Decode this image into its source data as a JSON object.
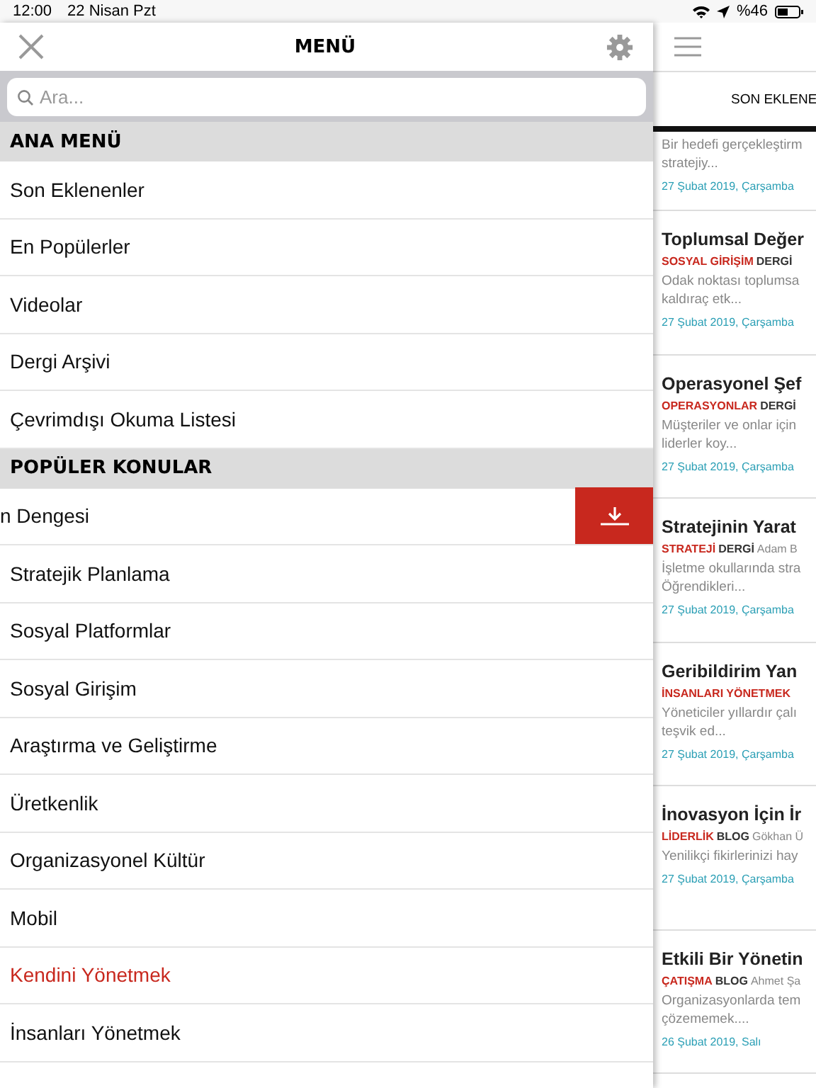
{
  "status_bar": {
    "time": "12:00",
    "date": "22 Nisan Pzt",
    "battery": "%46"
  },
  "menu": {
    "title": "MENÜ",
    "search": {
      "placeholder": "Ara..."
    },
    "sections": [
      {
        "title": "ANA MENÜ",
        "items": [
          {
            "label": "Son Eklenenler",
            "selected": false,
            "swiped": false
          },
          {
            "label": "En Popülerler",
            "selected": false,
            "swiped": false
          },
          {
            "label": "Videolar",
            "selected": false,
            "swiped": false
          },
          {
            "label": "Dergi Arşivi",
            "selected": false,
            "swiped": false
          },
          {
            "label": "Çevrimdışı Okuma Listesi",
            "selected": false,
            "swiped": false
          }
        ]
      },
      {
        "title": "POPÜLER KONULAR",
        "items": [
          {
            "label": "n Dengesi",
            "selected": false,
            "swiped": true
          },
          {
            "label": "Stratejik Planlama",
            "selected": false,
            "swiped": false
          },
          {
            "label": "Sosyal Platformlar",
            "selected": false,
            "swiped": false
          },
          {
            "label": "Sosyal Girişim",
            "selected": false,
            "swiped": false
          },
          {
            "label": "Araştırma ve Geliştirme",
            "selected": false,
            "swiped": false
          },
          {
            "label": "Üretkenlik",
            "selected": false,
            "swiped": false
          },
          {
            "label": "Organizasyonel Kültür",
            "selected": false,
            "swiped": false
          },
          {
            "label": "Mobil",
            "selected": false,
            "swiped": false
          },
          {
            "label": "Kendini Yönetmek",
            "selected": true,
            "swiped": false
          },
          {
            "label": "İnsanları Yönetmek",
            "selected": false,
            "swiped": false
          }
        ]
      }
    ]
  },
  "feed": {
    "tab": {
      "label": "SON EKLENE",
      "selected": true
    },
    "articles": [
      {
        "summary_lines": [
          "Bir hedefi gerçekleştirm",
          "stratejiy..."
        ],
        "date": "27 Şubat 2019, Çarşamba"
      },
      {
        "title": "Toplumsal Değer",
        "category": "SOSYAL GİRİŞİM",
        "type": "DERGİ",
        "summary_lines": [
          "Odak noktası toplumsa",
          "kaldıraç etk..."
        ],
        "date": "27 Şubat 2019, Çarşamba"
      },
      {
        "title": "Operasyonel Şef",
        "category": "OPERASYONLAR",
        "type": "DERGİ",
        "summary_lines": [
          "Müşteriler ve onlar için",
          "liderler koy..."
        ],
        "date": "27 Şubat 2019, Çarşamba"
      },
      {
        "title": "Stratejinin Yarat",
        "category": "STRATEJİ",
        "type": "DERGİ",
        "author": "Adam B",
        "summary_lines": [
          "İşletme okullarında stra",
          "Öğrendikleri..."
        ],
        "date": "27 Şubat 2019, Çarşamba"
      },
      {
        "title": "Geribildirim Yan",
        "category": "İNSANLARI YÖNETMEK",
        "summary_lines": [
          "Yöneticiler yıllardır çalı",
          "teşvik ed..."
        ],
        "date": "27 Şubat 2019, Çarşamba"
      },
      {
        "title": "İnovasyon İçin İr",
        "category": "LİDERLİK",
        "type": "BLOG",
        "author": "Gökhan Ü",
        "summary_lines": [
          "Yenilikçi fikirlerinizi hay"
        ],
        "date": "27 Şubat 2019, Çarşamba"
      },
      {
        "title": "Etkili Bir Yönetin",
        "category": "ÇATIŞMA",
        "type": "BLOG",
        "author": "Ahmet Şa",
        "summary_lines": [
          "Organizasyonlarda tem",
          "çözememek...."
        ],
        "date": "26 Şubat 2019, Salı"
      }
    ]
  }
}
